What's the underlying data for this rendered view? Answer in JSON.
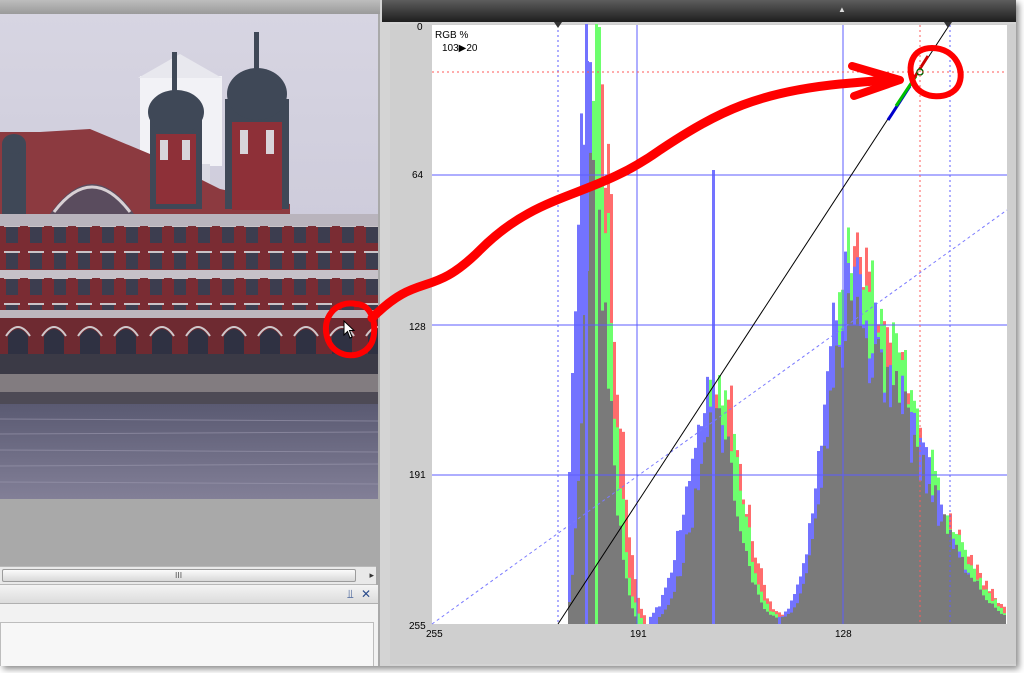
{
  "histogram": {
    "channel_label": "RGB %",
    "readout": "103▶20",
    "y_axis_ticks": [
      "0",
      "64",
      "128",
      "191",
      "255"
    ],
    "x_axis_ticks": [
      "255",
      "191",
      "128"
    ]
  },
  "colors": {
    "red_channel": "#ff6d6d",
    "green_channel": "#6dff6d",
    "blue_channel": "#7373ff",
    "luminance": "#7a7a7a",
    "grid": "#5c5cff",
    "annotation": "#ff0000",
    "background": "#ffffff"
  },
  "icons": {
    "pin": "pin-icon",
    "close": "close-icon",
    "cursor": "mouse-cursor-icon"
  },
  "panel": {
    "pin_glyph": "⫫",
    "close_glyph": "✕",
    "scroll_grip": "III",
    "scroll_right": "▸"
  }
}
